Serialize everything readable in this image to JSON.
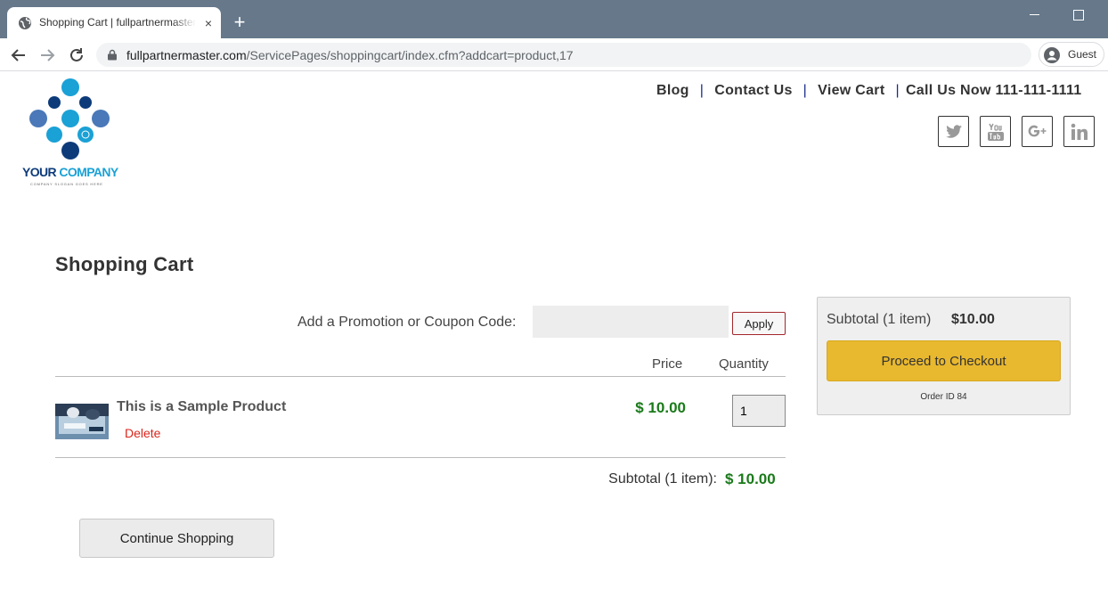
{
  "browser": {
    "tab_title": "Shopping Cart | fullpartnermaster.com",
    "tab_close": "×",
    "newtab": "+",
    "url_host": "fullpartnermaster.com",
    "url_path": "/ServicePages/shoppingcart/index.cfm?addcart=product,17",
    "profile_label": "Guest",
    "icons": [
      "globe-icon",
      "back-icon",
      "forward-icon",
      "reload-icon",
      "lock-icon",
      "profile-icon",
      "minimize-icon",
      "maximize-icon"
    ]
  },
  "header": {
    "logo_word1": "YOUR ",
    "logo_word2": "COMPANY",
    "logo_slogan": "COMPANY SLOGAN GOES HERE",
    "nav": {
      "blog": "Blog",
      "contact": "Contact Us",
      "view_cart": "View Cart",
      "phone": "Call Us Now 111-111-1111",
      "separator": "|"
    },
    "social": [
      "twitter-icon",
      "youtube-icon",
      "google-plus-icon",
      "linkedin-icon"
    ]
  },
  "cart": {
    "title": "Shopping Cart",
    "promo_label": "Add a Promotion or Coupon Code:",
    "promo_value": "",
    "apply_label": "Apply",
    "col_price": "Price",
    "col_quantity": "Quantity",
    "items": [
      {
        "name": "This is a Sample Product",
        "delete_label": "Delete",
        "price": "$ 10.00",
        "quantity": "1"
      }
    ],
    "subtotal_label": "Subtotal (1 item):",
    "subtotal_value": "$ 10.00",
    "continue_label": "Continue Shopping"
  },
  "summary": {
    "subtotal_label": "Subtotal (1 item)",
    "subtotal_value": "$10.00",
    "checkout_label": "Proceed to Checkout",
    "order_id": "Order ID 84"
  },
  "colors": {
    "chrome": "#66788a",
    "price_green": "#1a7a1a",
    "checkout_gold": "#e8b82e",
    "delete_red": "#d9261c"
  }
}
